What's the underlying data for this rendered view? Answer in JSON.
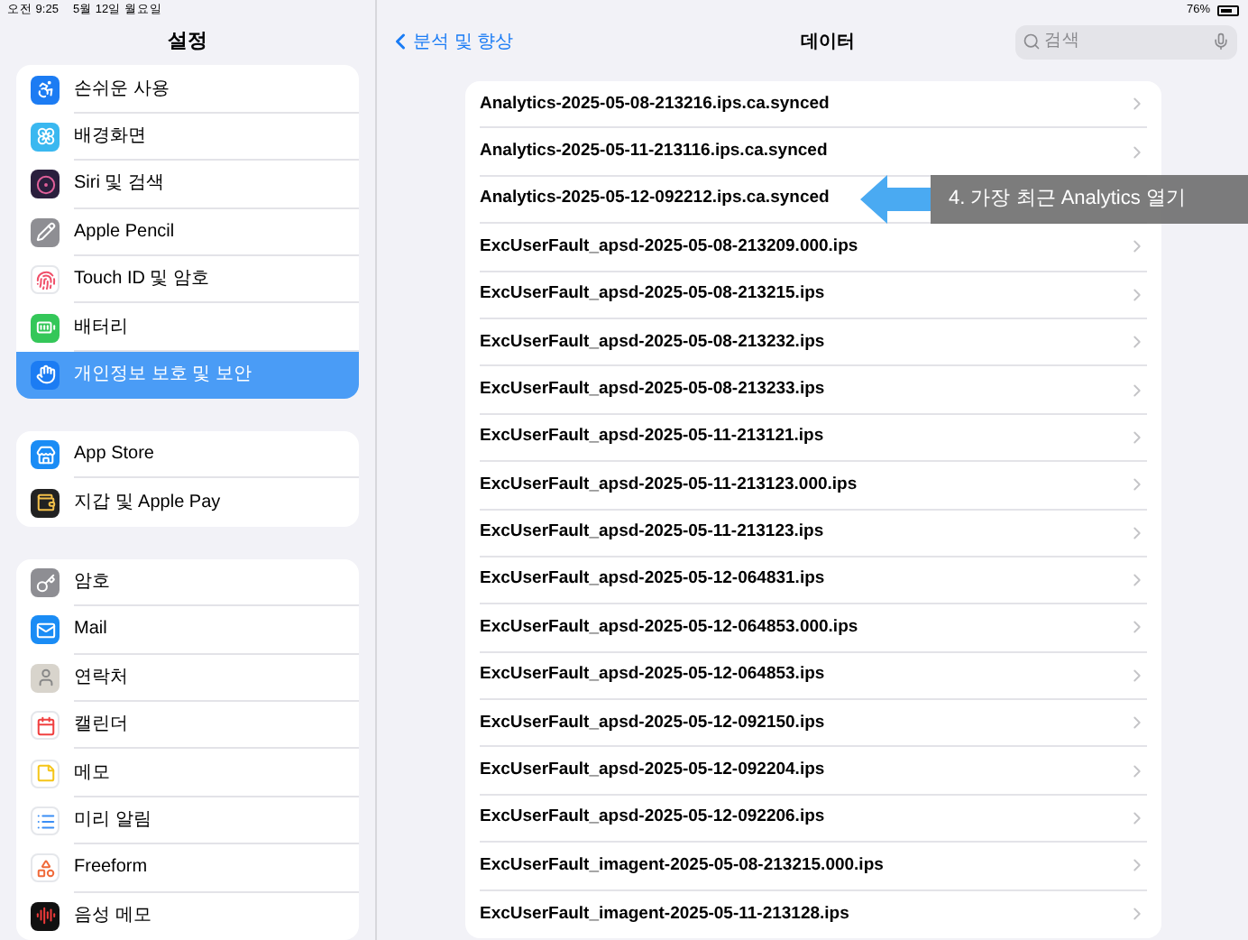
{
  "status_bar": {
    "time": "오전 9:25",
    "date": "5월 12일 월요일",
    "battery": "76%"
  },
  "sidebar": {
    "title": "설정",
    "groups": [
      {
        "items": [
          {
            "label": "손쉬운 사용",
            "selected": false
          },
          {
            "label": "배경화면",
            "selected": false
          },
          {
            "label": "Siri 및 검색",
            "selected": false
          },
          {
            "label": "Apple Pencil",
            "selected": false
          },
          {
            "label": "Touch ID 및 암호",
            "selected": false
          },
          {
            "label": "배터리",
            "selected": false
          },
          {
            "label": "개인정보 보호 및 보안",
            "selected": true
          }
        ]
      },
      {
        "items": [
          {
            "label": "App Store",
            "selected": false
          },
          {
            "label": "지갑 및 Apple Pay",
            "selected": false
          }
        ]
      },
      {
        "items": [
          {
            "label": "암호",
            "selected": false
          },
          {
            "label": "Mail",
            "selected": false
          },
          {
            "label": "연락처",
            "selected": false
          },
          {
            "label": "캘린더",
            "selected": false
          },
          {
            "label": "메모",
            "selected": false
          },
          {
            "label": "미리 알림",
            "selected": false
          },
          {
            "label": "Freeform",
            "selected": false
          },
          {
            "label": "음성 메모",
            "selected": false
          }
        ]
      }
    ]
  },
  "nav": {
    "back": "분석 및 향상",
    "title": "데이터",
    "search_placeholder": "검색"
  },
  "files": [
    "Analytics-2025-05-08-213216.ips.ca.synced",
    "Analytics-2025-05-11-213116.ips.ca.synced",
    {
      "name": "Analytics-2025-05-12-092212.ips.ca.synced",
      "callout": "4. 가장 최근 Analytics 열기"
    },
    "ExcUserFault_apsd-2025-05-08-213209.000.ips",
    "ExcUserFault_apsd-2025-05-08-213215.ips",
    "ExcUserFault_apsd-2025-05-08-213232.ips",
    "ExcUserFault_apsd-2025-05-08-213233.ips",
    "ExcUserFault_apsd-2025-05-11-213121.ips",
    "ExcUserFault_apsd-2025-05-11-213123.000.ips",
    "ExcUserFault_apsd-2025-05-11-213123.ips",
    "ExcUserFault_apsd-2025-05-12-064831.ips",
    "ExcUserFault_apsd-2025-05-12-064853.000.ips",
    "ExcUserFault_apsd-2025-05-12-064853.ips",
    "ExcUserFault_apsd-2025-05-12-092150.ips",
    "ExcUserFault_apsd-2025-05-12-092204.ips",
    "ExcUserFault_apsd-2025-05-12-092206.ips",
    "ExcUserFault_imagent-2025-05-08-213215.000.ips",
    "ExcUserFault_imagent-2025-05-11-213128.ips"
  ]
}
